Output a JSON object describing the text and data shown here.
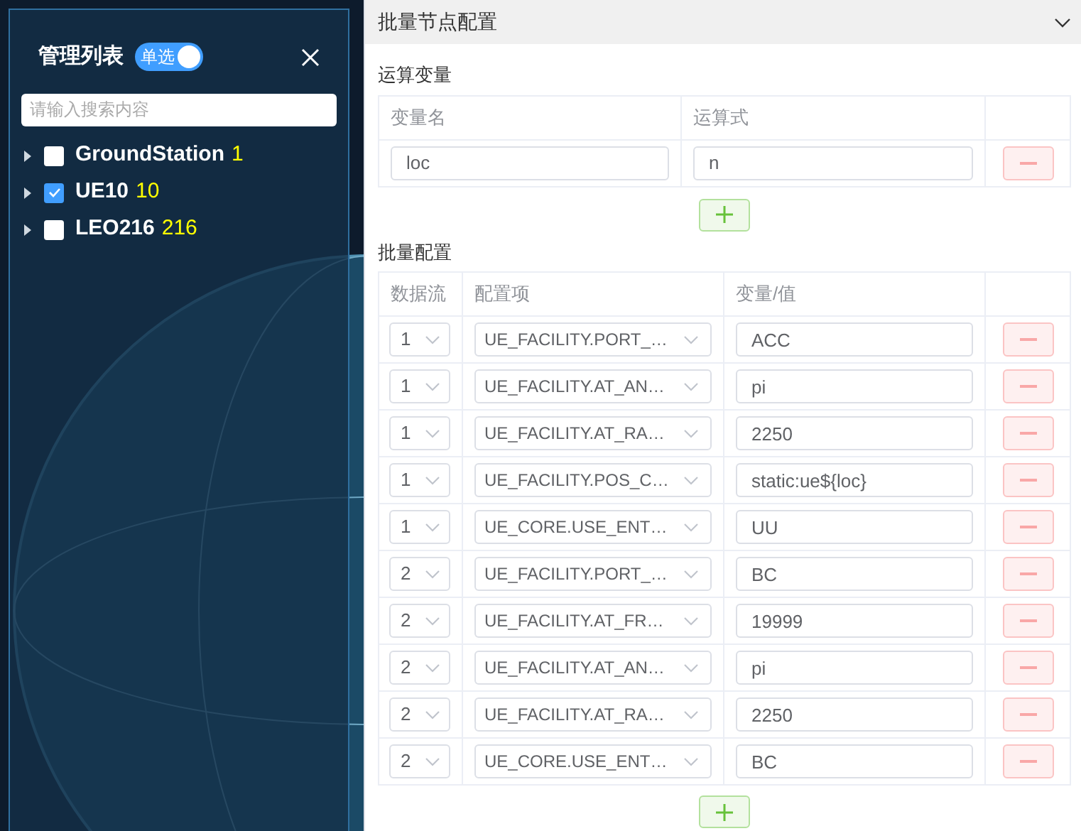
{
  "sidebar": {
    "title": "管理列表",
    "toggle": {
      "label": "单选",
      "on": true
    },
    "search": {
      "placeholder": "请输入搜索内容"
    },
    "items": [
      {
        "label": "GroundStation",
        "count": "1",
        "checked": false,
        "expanded": false
      },
      {
        "label": "UE10",
        "count": "10",
        "checked": true,
        "expanded": false
      },
      {
        "label": "LEO216",
        "count": "216",
        "checked": false,
        "expanded": false
      }
    ]
  },
  "panel": {
    "title": "批量节点配置",
    "expanded": true,
    "variables": {
      "title": "运算变量",
      "columns": [
        "变量名",
        "运算式"
      ],
      "rows": [
        {
          "name": "loc",
          "expression": "n"
        }
      ]
    },
    "batch": {
      "title": "批量配置",
      "columns": [
        "数据流",
        "配置项",
        "变量/值"
      ],
      "rows": [
        {
          "stream": "1",
          "item": "UE_FACILITY.PORT_…",
          "value": "ACC"
        },
        {
          "stream": "1",
          "item": "UE_FACILITY.AT_AN…",
          "value": "pi"
        },
        {
          "stream": "1",
          "item": "UE_FACILITY.AT_RA…",
          "value": "2250"
        },
        {
          "stream": "1",
          "item": "UE_FACILITY.POS_C…",
          "value": "static:ue${loc}"
        },
        {
          "stream": "1",
          "item": "UE_CORE.USE_ENT…",
          "value": "UU"
        },
        {
          "stream": "2",
          "item": "UE_FACILITY.PORT_…",
          "value": "BC"
        },
        {
          "stream": "2",
          "item": "UE_FACILITY.AT_FR…",
          "value": "19999"
        },
        {
          "stream": "2",
          "item": "UE_FACILITY.AT_AN…",
          "value": "pi"
        },
        {
          "stream": "2",
          "item": "UE_FACILITY.AT_RA…",
          "value": "2250"
        },
        {
          "stream": "2",
          "item": "UE_CORE.USE_ENT…",
          "value": "BC"
        }
      ]
    }
  }
}
